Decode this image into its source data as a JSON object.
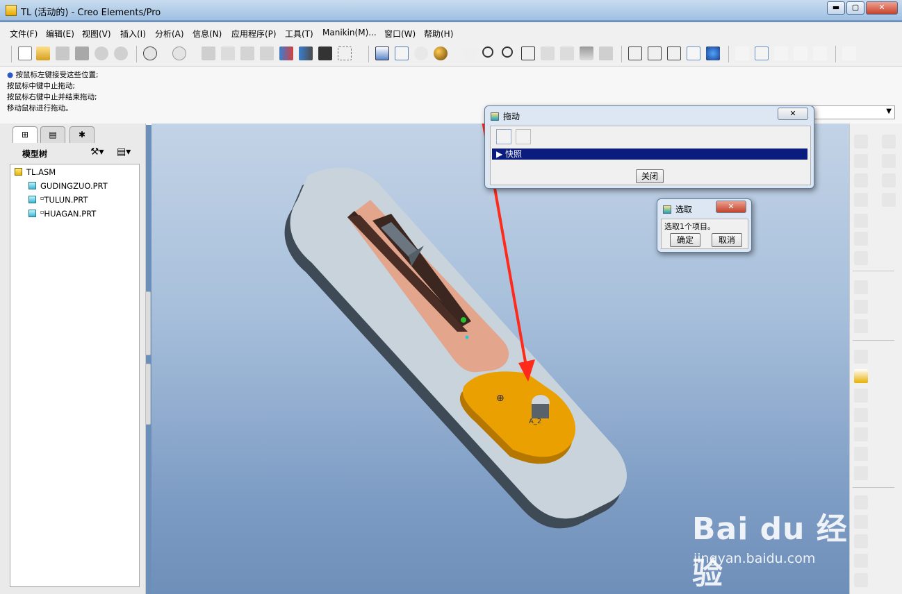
{
  "window": {
    "title": "TL (活动的) - Creo Elements/Pro",
    "min_label": "▬",
    "max_label": "▢",
    "close_label": "✕"
  },
  "menu": [
    "文件(F)",
    "编辑(E)",
    "视图(V)",
    "插入(I)",
    "分析(A)",
    "信息(N)",
    "应用程序(P)",
    "工具(T)",
    "Manikin(M)...",
    "窗口(W)",
    "帮助(H)"
  ],
  "messages": [
    "按鼠标左键接受这些位置;",
    "按鼠标中键中止拖动;",
    "按鼠标右键中止并结束拖动;",
    "移动鼠标进行拖动。"
  ],
  "model_tree": {
    "header": "模型树",
    "tabs": [
      "model-tree-icon",
      "layers-icon",
      "favorites-icon"
    ],
    "items": [
      {
        "name": "TL.ASM",
        "kind": "asm"
      },
      {
        "name": "GUDINGZUO.PRT",
        "kind": "prt"
      },
      {
        "name": "TULUN.PRT",
        "kind": "prt",
        "marker": "▫"
      },
      {
        "name": "HUAGAN.PRT",
        "kind": "prt",
        "marker": "▫"
      }
    ]
  },
  "drag_dialog": {
    "title": "拖动",
    "snapshot_label": "快照",
    "close_button": "关闭",
    "close_icon": "✕"
  },
  "select_dialog": {
    "title": "选取",
    "prompt": "选取1个项目。",
    "ok_button": "确定",
    "cancel_button": "取消",
    "close_icon": "✕"
  },
  "viewport": {
    "axis_label": "A_2"
  },
  "watermark": {
    "brand": "Bai du 经验",
    "url": "jingyan.baidu.com"
  },
  "colors": {
    "accent_arrow": "#ff2a1a",
    "cam_orange": "#eaa000",
    "slider_salmon": "#e3a58c",
    "base_plate": "#c8d3dc"
  }
}
